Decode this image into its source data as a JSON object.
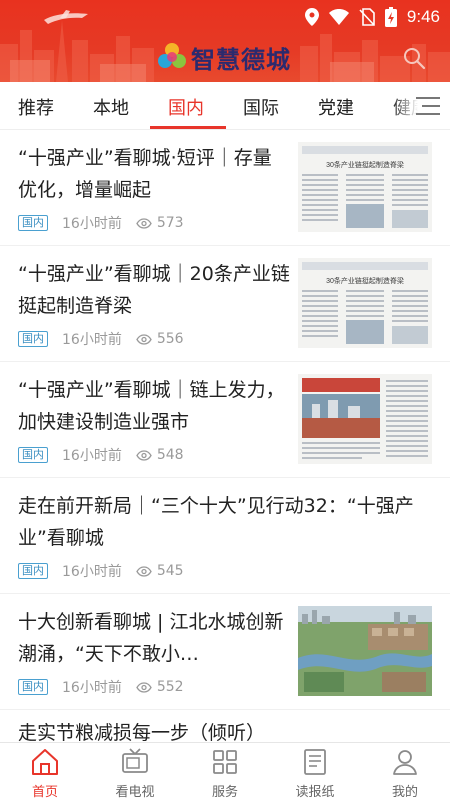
{
  "status_bar": {
    "time": "9:46"
  },
  "app": {
    "title": "智慧德城",
    "accent": "#e8352b",
    "header_color": "#e63a25",
    "tag_color": "#3b8fc2"
  },
  "header": {
    "search_icon": "search-icon",
    "menu_icon": "menu-icon"
  },
  "tabs": [
    {
      "label": "推荐",
      "active": false
    },
    {
      "label": "本地",
      "active": false
    },
    {
      "label": "国内",
      "active": true
    },
    {
      "label": "国际",
      "active": false
    },
    {
      "label": "党建",
      "active": false
    },
    {
      "label": "健康",
      "active": false
    }
  ],
  "news": [
    {
      "title": "“十强产业”看聊城·短评｜存量优化，增量崛起",
      "tag": "国内",
      "time": "16小时前",
      "views": "573",
      "thumb": "newspaper",
      "thumb_headline": "30条产业链挺起制造脊梁"
    },
    {
      "title": "“十强产业”看聊城｜20条产业链挺起制造脊梁",
      "tag": "国内",
      "time": "16小时前",
      "views": "556",
      "thumb": "newspaper",
      "thumb_headline": "30条产业链挺起制造脊梁"
    },
    {
      "title": "“十强产业”看聊城｜链上发力，加快建设制造业强市",
      "tag": "国内",
      "time": "16小时前",
      "views": "548",
      "thumb": "newspaper-photo"
    },
    {
      "title": "走在前开新局｜“三个十大”见行动32：“十强产业”看聊城",
      "tag": "国内",
      "time": "16小时前",
      "views": "545",
      "thumb": ""
    },
    {
      "title": "十大创新看聊城 | 江北水城创新潮涌，“天下不敢小…",
      "tag": "国内",
      "time": "16小时前",
      "views": "552",
      "thumb": "aerial-photo"
    }
  ],
  "partial_title": "走实节粮减损每一步（倾听）",
  "bottom_nav": [
    {
      "label": "首页",
      "icon": "home-icon",
      "active": true
    },
    {
      "label": "看电视",
      "icon": "tv-icon",
      "active": false
    },
    {
      "label": "服务",
      "icon": "grid-icon",
      "active": false
    },
    {
      "label": "读报纸",
      "icon": "newspaper-icon",
      "active": false
    },
    {
      "label": "我的",
      "icon": "user-icon",
      "active": false
    }
  ]
}
